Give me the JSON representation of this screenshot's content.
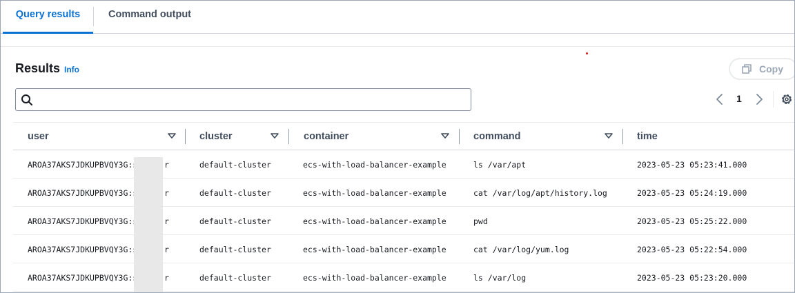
{
  "tabs": [
    {
      "label": "Query results",
      "active": true
    },
    {
      "label": "Command output",
      "active": false
    }
  ],
  "header": {
    "title": "Results",
    "info_label": "Info",
    "copy_label": "Copy"
  },
  "search": {
    "value": "",
    "placeholder": ""
  },
  "pagination": {
    "current_page": "1"
  },
  "table": {
    "columns": [
      "user",
      "cluster",
      "container",
      "command",
      "time"
    ],
    "rows": [
      [
        "AROA37AKS7JDKUPBVQY3G:s",
        "default-cluster",
        "ecs-with-load-balancer-example",
        "ls /var/apt",
        "2023-05-23 05:23:41.000"
      ],
      [
        "AROA37AKS7JDKUPBVQY3G:s",
        "default-cluster",
        "ecs-with-load-balancer-example",
        "cat /var/log/apt/history.log",
        "2023-05-23 05:24:19.000"
      ],
      [
        "AROA37AKS7JDKUPBVQY3G:s",
        "default-cluster",
        "ecs-with-load-balancer-example",
        "pwd",
        "2023-05-23 05:25:22.000"
      ],
      [
        "AROA37AKS7JDKUPBVQY3G:s",
        "default-cluster",
        "ecs-with-load-balancer-example",
        "cat /var/log/yum.log",
        "2023-05-23 05:22:54.000"
      ],
      [
        "AROA37AKS7JDKUPBVQY3G:s",
        "default-cluster",
        "ecs-with-load-balancer-example",
        "ls /var/log",
        "2023-05-23 05:23:20.000"
      ]
    ],
    "user_suffix": "r"
  },
  "colors": {
    "accent": "#0972d3",
    "text": "#16191f",
    "header_text": "#414d5c",
    "disabled": "#9ba7b6"
  },
  "icons": {
    "search": "search-icon",
    "copy": "copy-icon",
    "prev": "chevron-left-icon",
    "next": "chevron-right-icon",
    "settings": "gear-icon",
    "sort": "caret-down-icon"
  }
}
